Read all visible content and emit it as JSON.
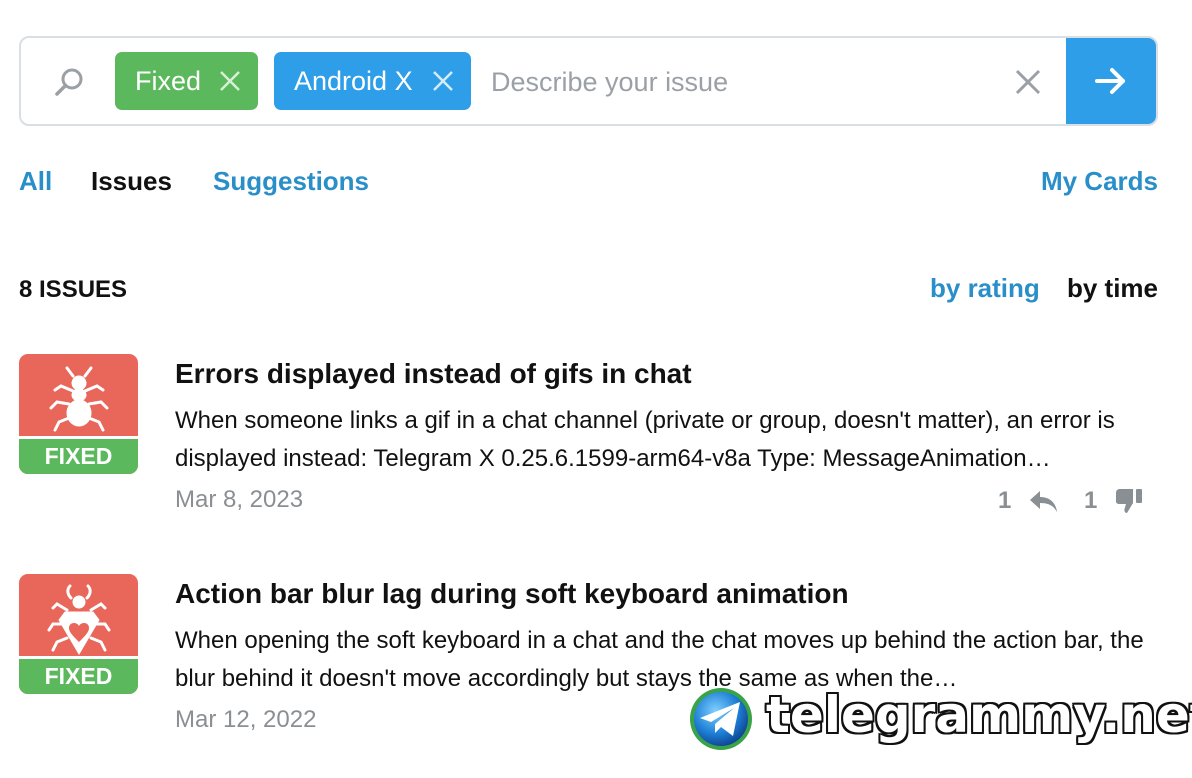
{
  "search": {
    "placeholder": "Describe your issue",
    "tags": [
      {
        "label": "Fixed",
        "color": "#5cb85c"
      },
      {
        "label": "Android X",
        "color": "#2f9ee8"
      }
    ]
  },
  "tabs": {
    "all": "All",
    "issues": "Issues",
    "suggestions": "Suggestions",
    "my_cards": "My Cards"
  },
  "list": {
    "count_label": "8 ISSUES",
    "sort_by_rating": "by rating",
    "sort_by_time": "by time"
  },
  "issues": [
    {
      "status": "FIXED",
      "title": "Errors displayed instead of gifs in chat",
      "description": "When someone links a gif in a chat channel (private or group, doesn't matter), an error is displayed instead: Telegram X 0.25.6.1599-arm64-v8a Type: MessageAnimation…",
      "date": "Mar 8, 2023",
      "replies": "1",
      "dislikes": "1"
    },
    {
      "status": "FIXED",
      "title": "Action bar blur lag during soft keyboard animation",
      "description": "When opening the soft keyboard in a chat and the chat moves up behind the action bar, the blur behind it doesn't move accordingly but stays the same as when the…",
      "date": "Mar 12, 2022"
    }
  ],
  "watermark": "telegrammy.net",
  "colors": {
    "accent": "#2f9ee8",
    "link": "#2a8fc9",
    "fixed_green": "#5cb85c",
    "bug_red": "#e8665a"
  }
}
